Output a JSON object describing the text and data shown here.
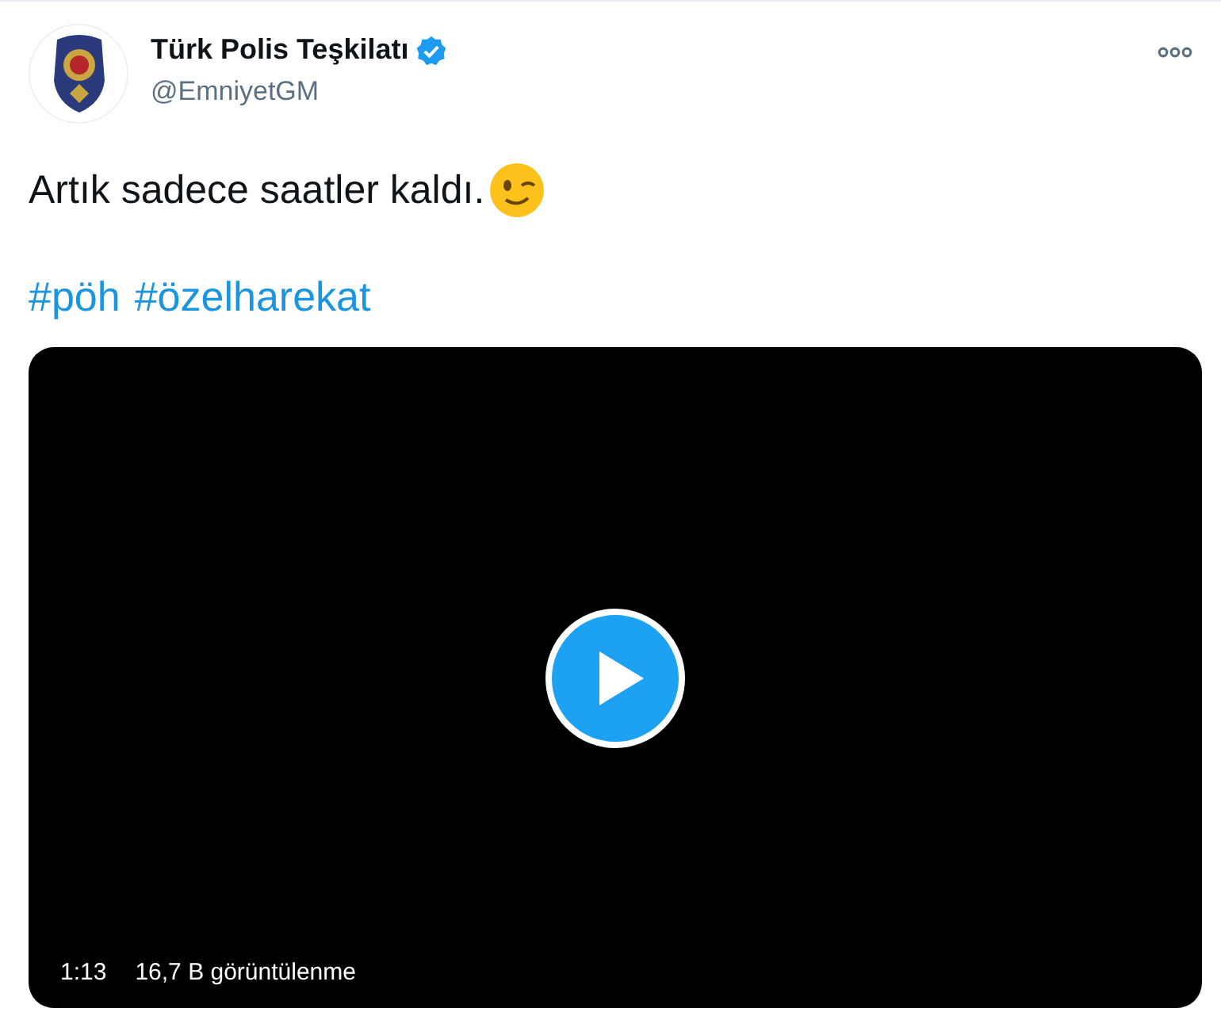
{
  "author": {
    "name": "Türk Polis Teşkilatı",
    "verified": true,
    "handle": "@EmniyetGM"
  },
  "tweet": {
    "text": "Artık sadece saatler kaldı.",
    "hashtags": [
      "#pöh",
      "#özelharekat"
    ]
  },
  "video": {
    "duration": "1:13",
    "views": "16,7 B görüntülenme"
  }
}
